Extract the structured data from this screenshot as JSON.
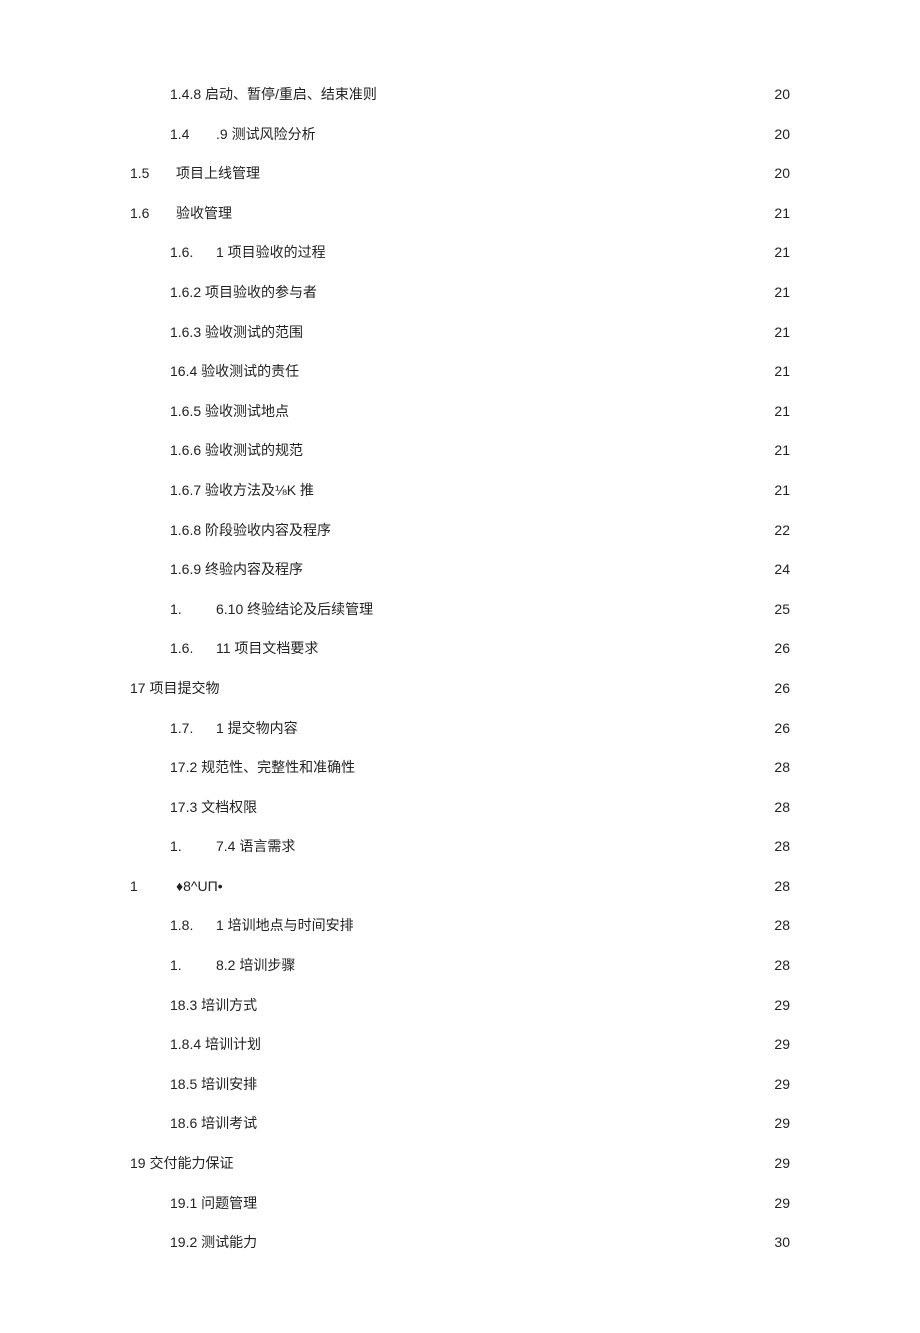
{
  "toc": [
    {
      "indent": 1,
      "prefix": "",
      "label": "1.4.8 启动、暂停/重启、结束准则",
      "leader": "dots",
      "page": "20"
    },
    {
      "indent": 1,
      "prefix": "1.4",
      "label": ".9 测试风险分析",
      "leader": "dots",
      "page": "20"
    },
    {
      "indent": 0,
      "prefix": "1.5",
      "label": "项目上线管理",
      "leader": "dots",
      "page": "20"
    },
    {
      "indent": 0,
      "prefix": "1.6",
      "label": "验收管理",
      "leader": "dots",
      "page": "21"
    },
    {
      "indent": 1,
      "prefix": "1.6.",
      "label": "1 项目验收的过程",
      "leader": "dots",
      "page": "21"
    },
    {
      "indent": 1,
      "prefix": "",
      "label": "1.6.2 项目验收的参与者",
      "leader": "dots",
      "page": "21"
    },
    {
      "indent": 1,
      "prefix": "",
      "label": "1.6.3 验收测试的范围",
      "leader": "dots",
      "page": "21"
    },
    {
      "indent": 1,
      "prefix": "",
      "label": "16.4 验收测试的责任",
      "leader": "dots",
      "page": "21"
    },
    {
      "indent": 1,
      "prefix": "",
      "label": "1.6.5 验收测试地点",
      "leader": "dots",
      "page": "21"
    },
    {
      "indent": 1,
      "prefix": "",
      "label": "1.6.6 验收测试的规范",
      "leader": "dots",
      "page": "21"
    },
    {
      "indent": 1,
      "prefix": "",
      "label": "1.6.7 验收方法及⅛K 推",
      "leader": "diamond",
      "page": "21"
    },
    {
      "indent": 1,
      "prefix": "",
      "label": "1.6.8 阶段验收内容及程序",
      "leader": "dots",
      "page": "22"
    },
    {
      "indent": 1,
      "prefix": "",
      "label": "1.6.9 终验内容及程序",
      "leader": "dots",
      "page": "24"
    },
    {
      "indent": 1,
      "prefix": "1.",
      "label": "6.10 终验结论及后续管理",
      "leader": "dots",
      "page": "25"
    },
    {
      "indent": 1,
      "prefix": "1.6.",
      "label": "11 项目文档要求",
      "leader": "dots",
      "page": "26"
    },
    {
      "indent": 0,
      "prefix": "",
      "label": "17 项目提交物",
      "leader": "dots",
      "page": "26"
    },
    {
      "indent": 1,
      "prefix": "1.7.",
      "label": "1 提交物内容",
      "leader": "dots",
      "page": "26"
    },
    {
      "indent": 1,
      "prefix": "",
      "label": "17.2 规范性、完整性和准确性",
      "leader": "dots",
      "page": "28"
    },
    {
      "indent": 1,
      "prefix": "",
      "label": "17.3 文档权限",
      "leader": "dots",
      "page": "28"
    },
    {
      "indent": 1,
      "prefix": "1.",
      "label": "7.4 语言需求",
      "leader": "dots",
      "page": "28"
    },
    {
      "indent": 0,
      "prefix": "1",
      "label": "♦8^UΠ•",
      "leader": "diamond",
      "page": "28"
    },
    {
      "indent": 1,
      "prefix": "1.8.",
      "label": "1 培训地点与时间安排",
      "leader": "dots",
      "page": "28"
    },
    {
      "indent": 1,
      "prefix": "1.",
      "label": "8.2 培训步骤",
      "leader": "dots",
      "page": "28"
    },
    {
      "indent": 1,
      "prefix": "",
      "label": "18.3 培训方式",
      "leader": "dots",
      "page": "29"
    },
    {
      "indent": 1,
      "prefix": "",
      "label": "1.8.4 培训计划",
      "leader": "dots",
      "page": "29"
    },
    {
      "indent": 1,
      "prefix": "",
      "label": "18.5 培训安排",
      "leader": "dots",
      "page": "29"
    },
    {
      "indent": 1,
      "prefix": "",
      "label": "18.6 培训考试",
      "leader": "dots",
      "page": "29"
    },
    {
      "indent": 0,
      "prefix": "",
      "label": "19 交付能力保证",
      "leader": "dots",
      "page": "29"
    },
    {
      "indent": 1,
      "prefix": "",
      "label": "19.1 问题管理",
      "leader": "dots",
      "page": "29"
    },
    {
      "indent": 1,
      "prefix": "",
      "label": "19.2 测试能力",
      "leader": "dots",
      "page": "30"
    }
  ]
}
